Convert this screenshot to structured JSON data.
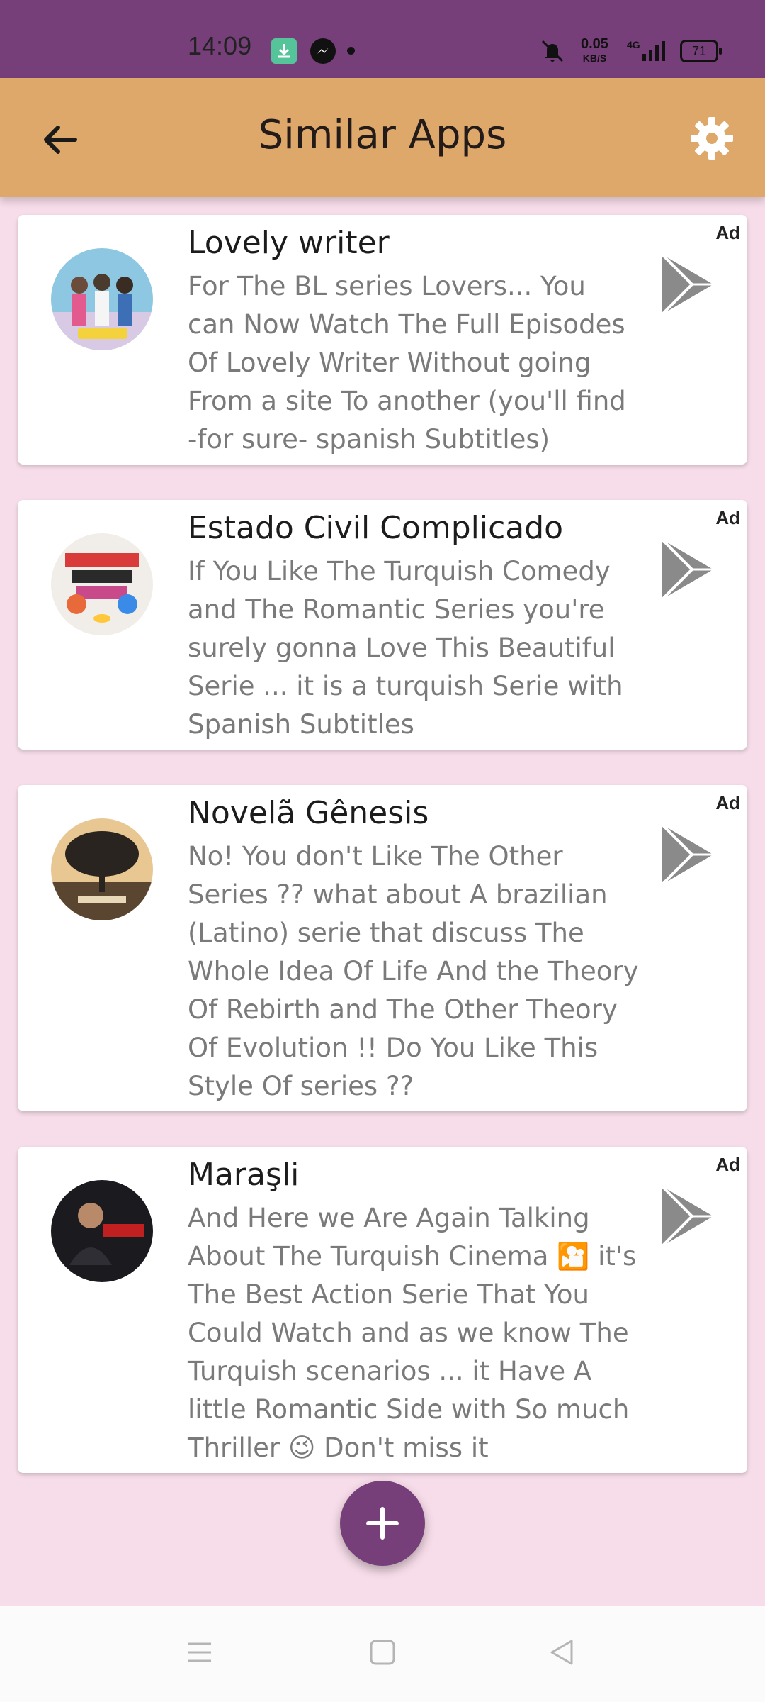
{
  "status_bar": {
    "time": "14:09",
    "net_speed": "0.05",
    "net_unit": "KB/S",
    "battery": "71"
  },
  "app_bar": {
    "title": "Similar Apps",
    "back_icon": "arrow-left-icon",
    "settings_icon": "gear-icon"
  },
  "apps": [
    {
      "title": "Lovely writer",
      "description": "For The BL series Lovers... You can Now Watch The Full Episodes Of Lovely Writer Without going From a site To another (you'll find -for sure- spanish Subtitles)",
      "ad_label": "Ad",
      "avatar_color": "#7fb9d6"
    },
    {
      "title": "Estado Civil Complicado",
      "description": "If You Like The Turquish Comedy and The Romantic Series you're surely gonna Love This Beautiful Serie ... it is a turquish Serie with Spanish Subtitles",
      "ad_label": "Ad",
      "avatar_color": "#e9e4de"
    },
    {
      "title": "Novelã Gênesis",
      "description": "No! You don't Like The Other Series ?? what about A brazilian (Latino) serie that discuss The Whole Idea Of Life And the Theory Of Rebirth and The Other Theory Of Evolution !! Do You Like This Style Of series ??",
      "ad_label": "Ad",
      "avatar_color": "#6b5a43"
    },
    {
      "title": "Maraşli",
      "description": "And Here we Are Again Talking About The Turquish Cinema 🎦 it's The Best Action Serie That You Could Watch and as we know The Turquish scenarios ... it Have A little Romantic Side with So much Thriller 😉 Don't miss it",
      "ad_label": "Ad",
      "avatar_color": "#1e1e22"
    }
  ],
  "colors": {
    "status_bar": "#773f7a",
    "app_bar": "#dea86a",
    "background": "#f7dde9",
    "fab": "#773f7a",
    "play_icon": "#8a8a8a"
  },
  "fab": {
    "icon": "plus-icon"
  },
  "nav": {
    "menu_icon": "menu-icon",
    "home_icon": "square-icon",
    "back_icon": "triangle-back-icon"
  }
}
